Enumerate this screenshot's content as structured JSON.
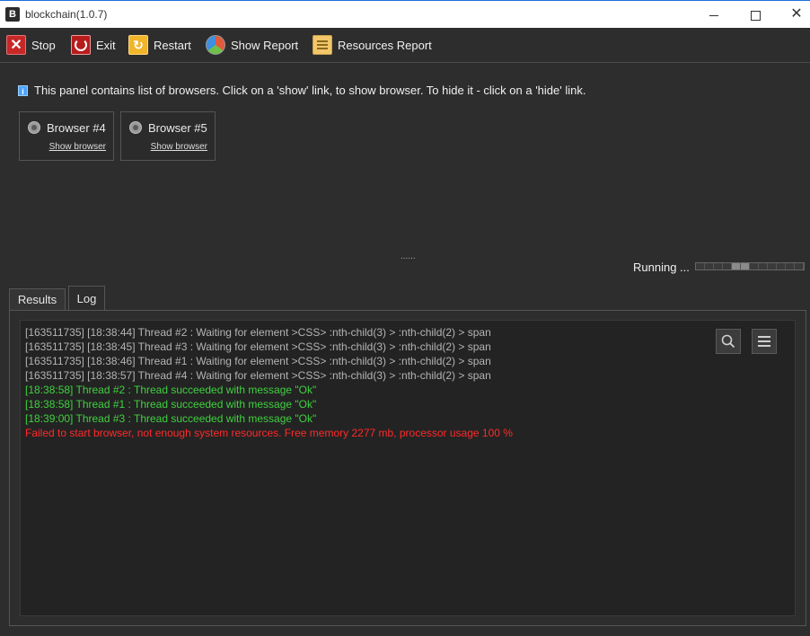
{
  "window": {
    "title": "blockchain(1.0.7)",
    "app_icon": "B",
    "controls": {
      "minimize": "minimize-icon",
      "maximize": "maximize-icon",
      "close": "✕"
    }
  },
  "toolbar": {
    "items": [
      {
        "label": "Stop",
        "icon": "stop-icon"
      },
      {
        "label": "Exit",
        "icon": "power-icon"
      },
      {
        "label": "Restart",
        "icon": "restart-icon"
      },
      {
        "label": "Show Report",
        "icon": "pie-chart-icon"
      },
      {
        "label": "Resources Report",
        "icon": "list-icon"
      }
    ]
  },
  "info": {
    "icon": "i",
    "text": "This panel contains list of browsers. Click on a 'show' link, to show browser. To hide it - click on a 'hide' link."
  },
  "browsers": [
    {
      "name": "Browser #4",
      "link": "Show browser"
    },
    {
      "name": "Browser #5",
      "link": "Show browser"
    }
  ],
  "splitter": "......",
  "status": {
    "text": "Running ...",
    "segments": 12,
    "active_segments": [
      4,
      5
    ]
  },
  "tabs": [
    {
      "label": "Results",
      "active": false
    },
    {
      "label": "Log",
      "active": true
    }
  ],
  "log": {
    "lines": [
      {
        "text": "[163511735] [18:38:44] Thread #2 : Waiting for element >CSS> :nth-child(3) > :nth-child(2) > span",
        "level": "gray"
      },
      {
        "text": "[163511735] [18:38:45] Thread #3 : Waiting for element >CSS> :nth-child(3) > :nth-child(2) > span",
        "level": "gray"
      },
      {
        "text": "[163511735] [18:38:46] Thread #1 : Waiting for element >CSS> :nth-child(3) > :nth-child(2) > span",
        "level": "gray"
      },
      {
        "text": "[163511735] [18:38:57] Thread #4 : Waiting for element >CSS> :nth-child(3) > :nth-child(2) > span",
        "level": "gray"
      },
      {
        "text": "[18:38:58] Thread #2 : Thread succeeded with message \"Ok\"",
        "level": "green"
      },
      {
        "text": "[18:38:58] Thread #1 : Thread succeeded with message \"Ok\"",
        "level": "green"
      },
      {
        "text": "[18:39:00] Thread #3 : Thread succeeded with message \"Ok\"",
        "level": "green"
      },
      {
        "text": "Failed to start browser, not enough system resources. Free memory 2277 mb, processor usage 100 %",
        "level": "red"
      }
    ],
    "buttons": {
      "search": "search-icon",
      "menu": "menu-icon"
    }
  },
  "colors": {
    "log_gray": "#b4b4b4",
    "log_green": "#3fd13f",
    "log_red": "#ff2a2a",
    "background": "#2d2d2d"
  }
}
